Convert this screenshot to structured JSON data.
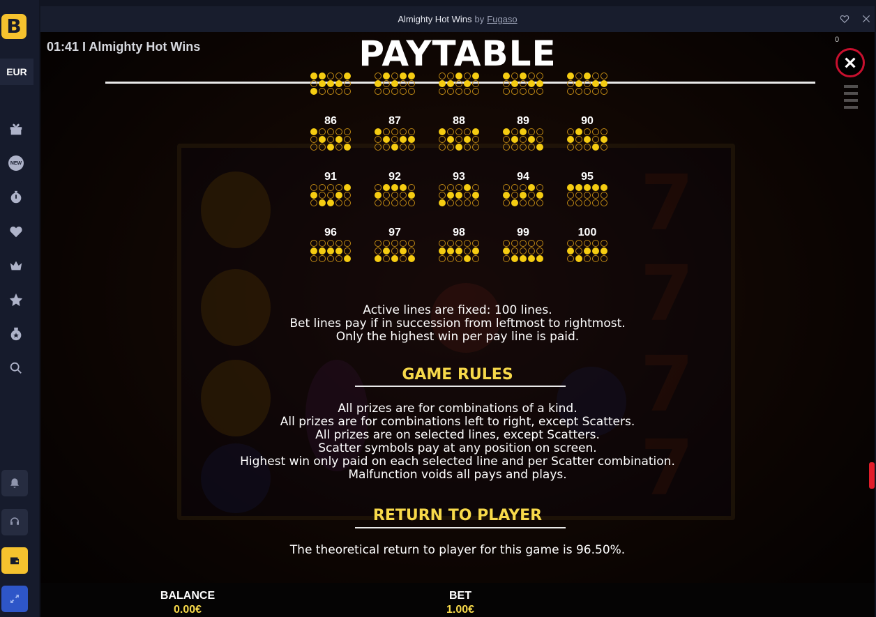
{
  "sidebar": {
    "logo_letter": "B",
    "currency": "EUR",
    "new_badge": "NEW",
    "items": [
      "gift-icon",
      "new-icon",
      "stopwatch-icon",
      "heart-icon",
      "crown-icon",
      "star-icon",
      "bonus-icon",
      "search-icon"
    ],
    "bottom_items": [
      "bell-icon",
      "headset-icon",
      "wallet-icon",
      "expand-icon"
    ]
  },
  "window": {
    "game_title": "Almighty Hot Wins",
    "by": "by",
    "provider": "Fugaso"
  },
  "session": {
    "label": "01:41 I Almighty Hot Wins",
    "counter": "0"
  },
  "paytable": {
    "title": "PAYTABLE",
    "lines": [
      {
        "num": "",
        "pattern": [
          [
            1,
            1,
            0,
            0,
            1
          ],
          [
            0,
            1,
            1,
            1,
            0
          ],
          [
            1,
            0,
            0,
            0,
            0
          ]
        ]
      },
      {
        "num": "",
        "pattern": [
          [
            0,
            1,
            0,
            1,
            1
          ],
          [
            1,
            0,
            1,
            0,
            0
          ],
          [
            0,
            0,
            0,
            0,
            0
          ]
        ]
      },
      {
        "num": "",
        "pattern": [
          [
            0,
            0,
            1,
            0,
            1
          ],
          [
            1,
            1,
            0,
            1,
            0
          ],
          [
            0,
            0,
            0,
            0,
            0
          ]
        ]
      },
      {
        "num": "",
        "pattern": [
          [
            1,
            0,
            1,
            0,
            0
          ],
          [
            0,
            1,
            0,
            1,
            1
          ],
          [
            0,
            0,
            0,
            0,
            0
          ]
        ]
      },
      {
        "num": "",
        "pattern": [
          [
            1,
            0,
            1,
            0,
            0
          ],
          [
            0,
            1,
            0,
            1,
            1
          ],
          [
            0,
            0,
            0,
            0,
            0
          ]
        ]
      },
      {
        "num": "86",
        "pattern": [
          [
            1,
            0,
            0,
            0,
            0
          ],
          [
            0,
            1,
            0,
            1,
            0
          ],
          [
            0,
            0,
            1,
            0,
            1
          ]
        ]
      },
      {
        "num": "87",
        "pattern": [
          [
            1,
            0,
            0,
            0,
            0
          ],
          [
            0,
            1,
            0,
            1,
            1
          ],
          [
            0,
            0,
            1,
            0,
            0
          ]
        ]
      },
      {
        "num": "88",
        "pattern": [
          [
            1,
            0,
            0,
            0,
            1
          ],
          [
            0,
            1,
            0,
            1,
            0
          ],
          [
            0,
            0,
            1,
            0,
            0
          ]
        ]
      },
      {
        "num": "89",
        "pattern": [
          [
            1,
            0,
            1,
            0,
            0
          ],
          [
            0,
            1,
            0,
            1,
            0
          ],
          [
            0,
            0,
            0,
            0,
            1
          ]
        ]
      },
      {
        "num": "90",
        "pattern": [
          [
            0,
            1,
            0,
            0,
            0
          ],
          [
            1,
            0,
            1,
            0,
            1
          ],
          [
            0,
            0,
            0,
            1,
            0
          ]
        ]
      },
      {
        "num": "91",
        "pattern": [
          [
            0,
            0,
            0,
            0,
            1
          ],
          [
            1,
            0,
            0,
            1,
            0
          ],
          [
            0,
            1,
            1,
            0,
            0
          ]
        ]
      },
      {
        "num": "92",
        "pattern": [
          [
            0,
            1,
            1,
            1,
            0
          ],
          [
            1,
            0,
            0,
            0,
            1
          ],
          [
            0,
            0,
            0,
            0,
            0
          ]
        ]
      },
      {
        "num": "93",
        "pattern": [
          [
            0,
            0,
            0,
            1,
            0
          ],
          [
            0,
            1,
            1,
            0,
            1
          ],
          [
            1,
            0,
            0,
            0,
            0
          ]
        ]
      },
      {
        "num": "94",
        "pattern": [
          [
            0,
            0,
            0,
            1,
            0
          ],
          [
            1,
            0,
            1,
            0,
            1
          ],
          [
            0,
            1,
            0,
            0,
            0
          ]
        ]
      },
      {
        "num": "95",
        "pattern": [
          [
            1,
            1,
            1,
            1,
            1
          ],
          [
            0,
            0,
            0,
            0,
            0
          ],
          [
            0,
            0,
            0,
            0,
            0
          ]
        ]
      },
      {
        "num": "96",
        "pattern": [
          [
            0,
            0,
            0,
            0,
            0
          ],
          [
            1,
            1,
            1,
            1,
            0
          ],
          [
            0,
            0,
            0,
            0,
            1
          ]
        ]
      },
      {
        "num": "97",
        "pattern": [
          [
            0,
            0,
            0,
            0,
            0
          ],
          [
            0,
            1,
            0,
            1,
            0
          ],
          [
            1,
            0,
            1,
            0,
            1
          ]
        ]
      },
      {
        "num": "98",
        "pattern": [
          [
            0,
            0,
            0,
            0,
            0
          ],
          [
            1,
            1,
            1,
            0,
            1
          ],
          [
            0,
            0,
            0,
            1,
            0
          ]
        ]
      },
      {
        "num": "99",
        "pattern": [
          [
            0,
            0,
            0,
            0,
            0
          ],
          [
            1,
            0,
            0,
            0,
            0
          ],
          [
            0,
            1,
            1,
            1,
            1
          ]
        ]
      },
      {
        "num": "100",
        "pattern": [
          [
            0,
            0,
            0,
            0,
            0
          ],
          [
            1,
            0,
            1,
            1,
            1
          ],
          [
            0,
            1,
            0,
            0,
            0
          ]
        ]
      }
    ],
    "lines_info": [
      "Active lines are fixed: 100 lines.",
      "Bet lines pay if in succession from leftmost to rightmost.",
      "Only the highest win per pay line is paid."
    ],
    "rules_title": "GAME RULES",
    "rules": [
      "All prizes are for combinations of a kind.",
      "All prizes are for combinations left to right, except Scatters.",
      "All prizes are on selected lines, except Scatters.",
      "Scatter symbols pay at any position on screen.",
      "Highest win only paid on each selected line and per Scatter combination.",
      "Malfunction voids all pays and plays."
    ],
    "rtp_title": "RETURN TO PLAYER",
    "rtp_text": "The theoretical return to player for this game is 96.50%."
  },
  "footer": {
    "balance_label": "BALANCE",
    "balance_value": "0.00€",
    "bet_label": "BET",
    "bet_value": "1.00€"
  },
  "colors": {
    "accent": "#f5c22e",
    "dot_on": "#f5cc12",
    "heading": "#f7d94a",
    "close_ring": "#c8102e"
  }
}
